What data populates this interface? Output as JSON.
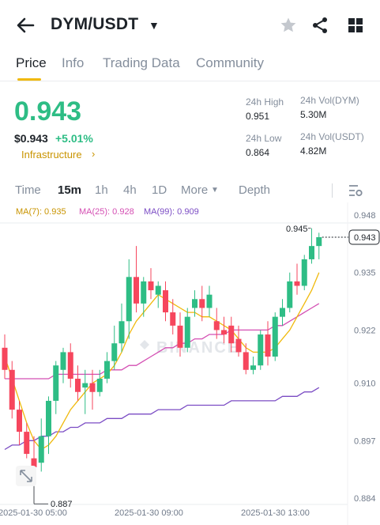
{
  "header": {
    "pair": "DYM/USDT",
    "icons": {
      "back": "arrow-left-icon",
      "favorite": "star-icon",
      "share": "share-icon",
      "more": "grid-icon"
    }
  },
  "tabs": [
    {
      "label": "Price",
      "active": true
    },
    {
      "label": "Info",
      "active": false
    },
    {
      "label": "Trading Data",
      "active": false
    },
    {
      "label": "Community",
      "active": false
    }
  ],
  "ticker": {
    "last_price": "0.943",
    "usd_price": "$0.943",
    "change_pct": "+5.01%",
    "tag": "Infrastructure",
    "high_label": "24h High",
    "high_value": "0.951",
    "low_label": "24h Low",
    "low_value": "0.864",
    "vol_base_label": "24h Vol(DYM)",
    "vol_base_value": "5.30M",
    "vol_quote_label": "24h Vol(USDT)",
    "vol_quote_value": "4.82M"
  },
  "intervals": {
    "items": [
      "Time",
      "15m",
      "1h",
      "4h",
      "1D"
    ],
    "active": "15m",
    "more_label": "More",
    "depth_label": "Depth"
  },
  "indicators": {
    "ma7": "MA(7): 0.935",
    "ma25": "MA(25): 0.928",
    "ma99": "MA(99): 0.909"
  },
  "colors": {
    "up": "#2ebd85",
    "down": "#f6465d",
    "ma7": "#f0b90b",
    "ma25": "#d44fb3",
    "ma99": "#7b4cc4",
    "accent": "#f0b90b"
  },
  "chart_data": {
    "type": "candlestick",
    "y_ticks": [
      "0.948",
      "0.935",
      "0.922",
      "0.910",
      "0.897",
      "0.884"
    ],
    "ylim": [
      0.884,
      0.948
    ],
    "x_labels": [
      "2025-01-30 05:00",
      "2025-01-30 09:00",
      "2025-01-30 13:00"
    ],
    "current_price_label": "0.943",
    "current_price": 0.943,
    "high_marker_label": "0.945",
    "high_marker": 0.945,
    "low_marker_label": "0.887",
    "low_marker": 0.887,
    "watermark": "BINANCE",
    "candles": [
      {
        "o": 0.918,
        "h": 0.921,
        "l": 0.911,
        "c": 0.913
      },
      {
        "o": 0.913,
        "h": 0.915,
        "l": 0.902,
        "c": 0.904
      },
      {
        "o": 0.904,
        "h": 0.906,
        "l": 0.896,
        "c": 0.899
      },
      {
        "o": 0.899,
        "h": 0.901,
        "l": 0.893,
        "c": 0.894
      },
      {
        "o": 0.893,
        "h": 0.898,
        "l": 0.887,
        "c": 0.891
      },
      {
        "o": 0.892,
        "h": 0.902,
        "l": 0.89,
        "c": 0.898
      },
      {
        "o": 0.898,
        "h": 0.907,
        "l": 0.894,
        "c": 0.906
      },
      {
        "o": 0.906,
        "h": 0.915,
        "l": 0.903,
        "c": 0.914
      },
      {
        "o": 0.913,
        "h": 0.918,
        "l": 0.91,
        "c": 0.917
      },
      {
        "o": 0.917,
        "h": 0.919,
        "l": 0.909,
        "c": 0.911
      },
      {
        "o": 0.911,
        "h": 0.914,
        "l": 0.906,
        "c": 0.908
      },
      {
        "o": 0.909,
        "h": 0.913,
        "l": 0.903,
        "c": 0.91
      },
      {
        "o": 0.91,
        "h": 0.913,
        "l": 0.904,
        "c": 0.908
      },
      {
        "o": 0.908,
        "h": 0.913,
        "l": 0.907,
        "c": 0.911
      },
      {
        "o": 0.911,
        "h": 0.917,
        "l": 0.91,
        "c": 0.915
      },
      {
        "o": 0.915,
        "h": 0.923,
        "l": 0.913,
        "c": 0.919
      },
      {
        "o": 0.919,
        "h": 0.928,
        "l": 0.917,
        "c": 0.924
      },
      {
        "o": 0.924,
        "h": 0.938,
        "l": 0.92,
        "c": 0.934
      },
      {
        "o": 0.934,
        "h": 0.941,
        "l": 0.926,
        "c": 0.928
      },
      {
        "o": 0.928,
        "h": 0.934,
        "l": 0.925,
        "c": 0.933
      },
      {
        "o": 0.933,
        "h": 0.936,
        "l": 0.929,
        "c": 0.931
      },
      {
        "o": 0.93,
        "h": 0.933,
        "l": 0.927,
        "c": 0.932
      },
      {
        "o": 0.931,
        "h": 0.933,
        "l": 0.924,
        "c": 0.926
      },
      {
        "o": 0.926,
        "h": 0.929,
        "l": 0.921,
        "c": 0.923
      },
      {
        "o": 0.923,
        "h": 0.926,
        "l": 0.916,
        "c": 0.918
      },
      {
        "o": 0.918,
        "h": 0.927,
        "l": 0.917,
        "c": 0.925
      },
      {
        "o": 0.927,
        "h": 0.931,
        "l": 0.925,
        "c": 0.929
      },
      {
        "o": 0.929,
        "h": 0.932,
        "l": 0.924,
        "c": 0.927
      },
      {
        "o": 0.927,
        "h": 0.932,
        "l": 0.925,
        "c": 0.93
      },
      {
        "o": 0.924,
        "h": 0.927,
        "l": 0.92,
        "c": 0.922
      },
      {
        "o": 0.922,
        "h": 0.925,
        "l": 0.919,
        "c": 0.921
      },
      {
        "o": 0.923,
        "h": 0.925,
        "l": 0.917,
        "c": 0.919
      },
      {
        "o": 0.92,
        "h": 0.923,
        "l": 0.916,
        "c": 0.917
      },
      {
        "o": 0.917,
        "h": 0.919,
        "l": 0.912,
        "c": 0.913
      },
      {
        "o": 0.913,
        "h": 0.916,
        "l": 0.912,
        "c": 0.914
      },
      {
        "o": 0.914,
        "h": 0.922,
        "l": 0.913,
        "c": 0.921
      },
      {
        "o": 0.921,
        "h": 0.924,
        "l": 0.914,
        "c": 0.916
      },
      {
        "o": 0.916,
        "h": 0.926,
        "l": 0.915,
        "c": 0.925
      },
      {
        "o": 0.925,
        "h": 0.929,
        "l": 0.923,
        "c": 0.927
      },
      {
        "o": 0.927,
        "h": 0.935,
        "l": 0.926,
        "c": 0.933
      },
      {
        "o": 0.933,
        "h": 0.937,
        "l": 0.93,
        "c": 0.932
      },
      {
        "o": 0.932,
        "h": 0.939,
        "l": 0.931,
        "c": 0.938
      },
      {
        "o": 0.938,
        "h": 0.945,
        "l": 0.937,
        "c": 0.941
      },
      {
        "o": 0.941,
        "h": 0.944,
        "l": 0.938,
        "c": 0.943
      }
    ],
    "ma7": [
      0.916,
      0.911,
      0.906,
      0.901,
      0.897,
      0.895,
      0.896,
      0.898,
      0.901,
      0.904,
      0.906,
      0.908,
      0.91,
      0.911,
      0.912,
      0.914,
      0.917,
      0.921,
      0.924,
      0.926,
      0.928,
      0.93,
      0.929,
      0.928,
      0.927,
      0.926,
      0.926,
      0.925,
      0.925,
      0.924,
      0.923,
      0.922,
      0.92,
      0.918,
      0.917,
      0.917,
      0.917,
      0.918,
      0.92,
      0.922,
      0.925,
      0.928,
      0.931,
      0.935
    ],
    "ma25": [
      0.911,
      0.911,
      0.911,
      0.911,
      0.911,
      0.911,
      0.911,
      0.912,
      0.912,
      0.912,
      0.912,
      0.912,
      0.912,
      0.912,
      0.913,
      0.913,
      0.913,
      0.914,
      0.914,
      0.915,
      0.916,
      0.917,
      0.918,
      0.918,
      0.919,
      0.919,
      0.92,
      0.92,
      0.921,
      0.921,
      0.921,
      0.922,
      0.922,
      0.922,
      0.922,
      0.922,
      0.922,
      0.923,
      0.923,
      0.924,
      0.925,
      0.926,
      0.927,
      0.928
    ],
    "ma99": [
      0.895,
      0.896,
      0.896,
      0.897,
      0.897,
      0.898,
      0.898,
      0.899,
      0.899,
      0.9,
      0.9,
      0.901,
      0.901,
      0.901,
      0.902,
      0.902,
      0.902,
      0.903,
      0.903,
      0.903,
      0.903,
      0.904,
      0.904,
      0.904,
      0.904,
      0.905,
      0.905,
      0.905,
      0.905,
      0.905,
      0.905,
      0.906,
      0.906,
      0.906,
      0.906,
      0.906,
      0.906,
      0.906,
      0.907,
      0.907,
      0.907,
      0.908,
      0.908,
      0.909
    ]
  }
}
